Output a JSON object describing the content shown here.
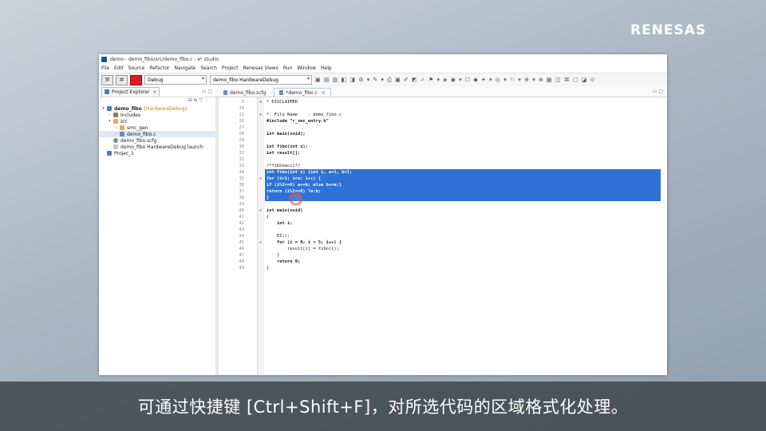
{
  "brand": {
    "logo_text": "RENESAS"
  },
  "window": {
    "title": "demo - demo_fibo/src/demo_fibo.c - e² studio"
  },
  "menu": [
    "File",
    "Edit",
    "Source",
    "Refactor",
    "Navigate",
    "Search",
    "Project",
    "Renesas Views",
    "Run",
    "Window",
    "Help"
  ],
  "toolbar": {
    "build_config": "Debug",
    "launch_config": "demo_fibo HardwareDebug"
  },
  "explorer": {
    "tab_label": "Project Explorer",
    "tree": [
      {
        "label": "demo_fibo",
        "annotation": "[HardwareDebug]",
        "icon": "project-icon",
        "indent": 0,
        "expander": "v"
      },
      {
        "label": "Includes",
        "annotation": "",
        "icon": "includes-icon",
        "indent": 1,
        "expander": ">"
      },
      {
        "label": "src",
        "annotation": "",
        "icon": "folder-icon",
        "indent": 1,
        "expander": "v"
      },
      {
        "label": "smc_gen",
        "annotation": "",
        "icon": "folder-icon",
        "indent": 2,
        "expander": ">"
      },
      {
        "label": "demo_fibo.c",
        "annotation": "",
        "icon": "c-file-icon",
        "indent": 2,
        "expander": ">"
      },
      {
        "label": "demo_fibo.scfg",
        "annotation": "",
        "icon": "scfg-icon",
        "indent": 1,
        "expander": ""
      },
      {
        "label": "demo_fibo HardwareDebug.launch",
        "annotation": "",
        "icon": "launch-icon",
        "indent": 1,
        "expander": ""
      },
      {
        "label": "Projec_1",
        "annotation": "",
        "icon": "project-icon",
        "indent": 0,
        "expander": ""
      }
    ]
  },
  "editor": {
    "tabs": [
      {
        "label": "demo_fibo.scfg",
        "active": false
      },
      {
        "label": "*demo_fibo.c",
        "active": true
      }
    ],
    "lines": [
      {
        "n": "2",
        "fold": "⊕",
        "text": "* DISCLAIMER",
        "hl": false,
        "style": "cm"
      },
      {
        "n": "19",
        "fold": "",
        "text": "",
        "hl": false,
        "style": ""
      },
      {
        "n": "21",
        "fold": "⊕",
        "text": "*  File Name    : demo_fibo.c",
        "hl": false,
        "style": "cm"
      },
      {
        "n": "26",
        "fold": "",
        "text": "#include \"r_smc_entry.h\"",
        "hl": false,
        "style": "inc"
      },
      {
        "n": "27",
        "fold": "",
        "text": "",
        "hl": false,
        "style": ""
      },
      {
        "n": "28",
        "fold": "",
        "text": "int main(void);",
        "hl": false,
        "style": "kw"
      },
      {
        "n": "29",
        "fold": "",
        "text": "",
        "hl": false,
        "style": ""
      },
      {
        "n": "30",
        "fold": "",
        "text": "int fibo(int x);",
        "hl": false,
        "style": "kw"
      },
      {
        "n": "31",
        "fold": "",
        "text": "int result[];",
        "hl": false,
        "style": "kw"
      },
      {
        "n": "32",
        "fold": "",
        "text": "",
        "hl": false,
        "style": ""
      },
      {
        "n": "33",
        "fold": "",
        "text": "/*fibonacci*/",
        "hl": false,
        "style": "cm"
      },
      {
        "n": "34",
        "fold": "",
        "text": "int fibo(int x) {int i, a=1, b=1;",
        "hl": true,
        "style": ""
      },
      {
        "n": "35",
        "fold": "⊖",
        "text": "for (i=1; i<x; i++) {",
        "hl": true,
        "style": ""
      },
      {
        "n": "36",
        "fold": "",
        "text": "if (i%2==0) a+=b; else b+=a;}",
        "hl": true,
        "style": ""
      },
      {
        "n": "37",
        "fold": "",
        "text": "return (i%2==0) ?a:b;",
        "hl": true,
        "style": ""
      },
      {
        "n": "38",
        "fold": "",
        "text": "}",
        "hl": true,
        "style": ""
      },
      {
        "n": "39",
        "fold": "",
        "text": "",
        "hl": false,
        "style": ""
      },
      {
        "n": "40",
        "fold": "⊖",
        "text": "int main(void)",
        "hl": false,
        "style": "kw"
      },
      {
        "n": "41",
        "fold": "",
        "text": "{",
        "hl": false,
        "style": ""
      },
      {
        "n": "42",
        "fold": "",
        "text": "    int i;",
        "hl": false,
        "style": "kw"
      },
      {
        "n": "43",
        "fold": "",
        "text": "",
        "hl": false,
        "style": ""
      },
      {
        "n": "44",
        "fold": "",
        "text": "    EI();",
        "hl": false,
        "style": ""
      },
      {
        "n": "45",
        "fold": "⊖",
        "text": "    for (i = 0; i < 5; i++) {",
        "hl": false,
        "style": "kw"
      },
      {
        "n": "46",
        "fold": "",
        "text": "        result[i] = fibo(i);",
        "hl": false,
        "style": ""
      },
      {
        "n": "47",
        "fold": "",
        "text": "    }",
        "hl": false,
        "style": ""
      },
      {
        "n": "48",
        "fold": "",
        "text": "    return 0;",
        "hl": false,
        "style": "kw"
      },
      {
        "n": "49",
        "fold": "",
        "text": "}",
        "hl": false,
        "style": ""
      }
    ]
  },
  "subtitle": "可通过快捷键 [Ctrl+Shift+F]，对所选代码的区域格式化处理。"
}
